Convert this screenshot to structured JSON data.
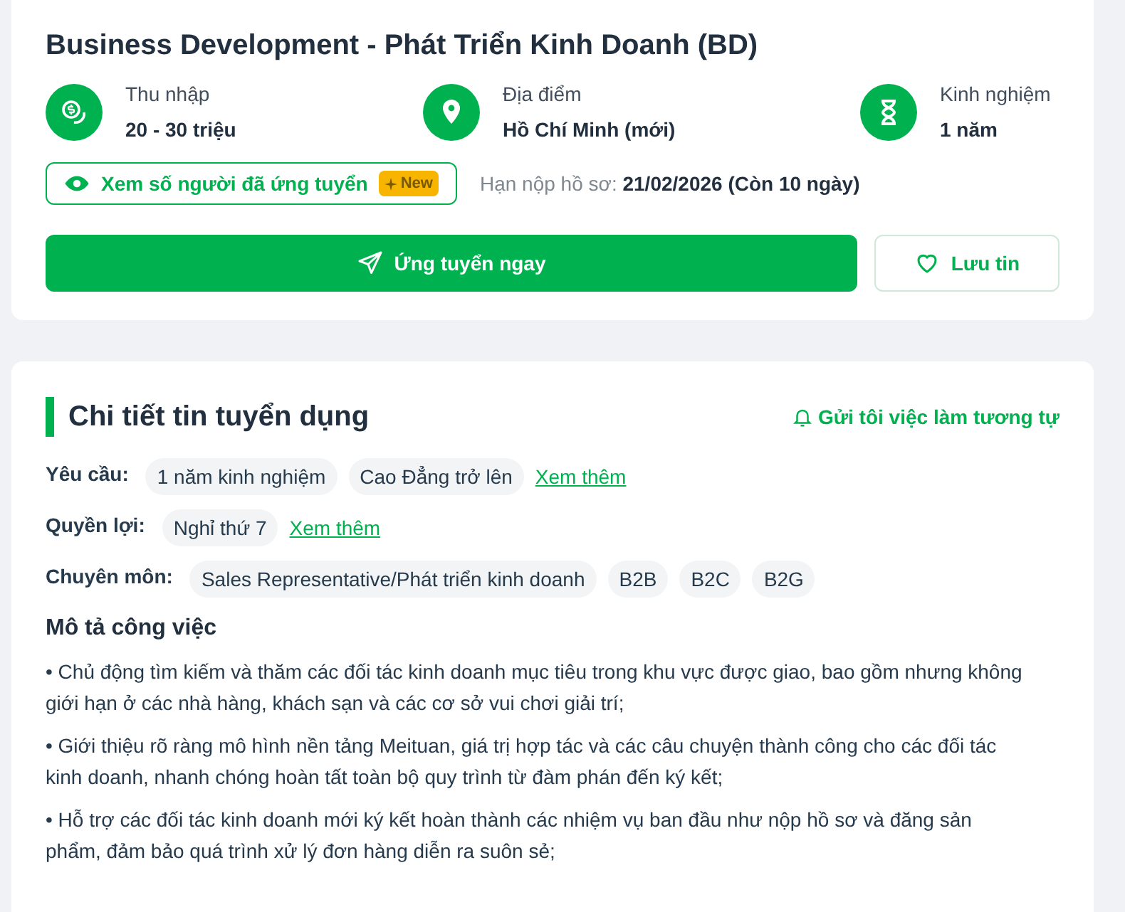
{
  "job": {
    "title": "Business Development - Phát Triển Kinh Doanh (BD)",
    "info": [
      {
        "kind": "money",
        "label": "Thu nhập",
        "value": "20 - 30 triệu"
      },
      {
        "kind": "location",
        "label": "Địa điểm",
        "value": "Hồ Chí Minh (mới)"
      },
      {
        "kind": "experience",
        "label": "Kinh nghiệm",
        "value": "1 năm"
      }
    ],
    "applicants_button": {
      "label": "Xem số người đã ứng tuyển",
      "badge": "New"
    },
    "deadline": {
      "label": "Hạn nộp hồ sơ:",
      "value": "21/02/2026 (Còn 10 ngày)"
    },
    "apply_button": "Ứng tuyển ngay",
    "save_button": "Lưu tin"
  },
  "details": {
    "heading": "Chi tiết tin tuyển dụng",
    "notify_link": "Gửi tôi việc làm tương tự",
    "rows": [
      {
        "label": "Yêu cầu:",
        "tags": [
          "1 năm kinh nghiệm",
          "Cao Đẳng trở lên"
        ],
        "more": "Xem thêm"
      },
      {
        "label": "Quyền lợi:",
        "tags": [
          "Nghỉ thứ 7"
        ],
        "more": "Xem thêm"
      },
      {
        "label": "Chuyên môn:",
        "tags": [
          "Sales Representative/Phát triển kinh doanh",
          "B2B",
          "B2C",
          "B2G"
        ]
      }
    ],
    "description_heading": "Mô tả công việc",
    "description": [
      "• Chủ động tìm kiếm và thăm các đối tác kinh doanh mục tiêu trong khu vực được giao, bao gồm nhưng không giới hạn ở các nhà hàng, khách sạn và các cơ sở vui chơi giải trí;",
      "• Giới thiệu rõ ràng mô hình nền tảng Meituan, giá trị hợp tác và các câu chuyện thành công cho các đối tác kinh doanh, nhanh chóng hoàn tất toàn bộ quy trình từ đàm phán đến ký kết;",
      "• Hỗ trợ các đối tác kinh doanh mới ký kết hoàn thành các nhiệm vụ ban đầu như nộp hồ sơ và đăng sản phẩm, đảm bảo quá trình xử lý đơn hàng diễn ra suôn sẻ;"
    ]
  }
}
